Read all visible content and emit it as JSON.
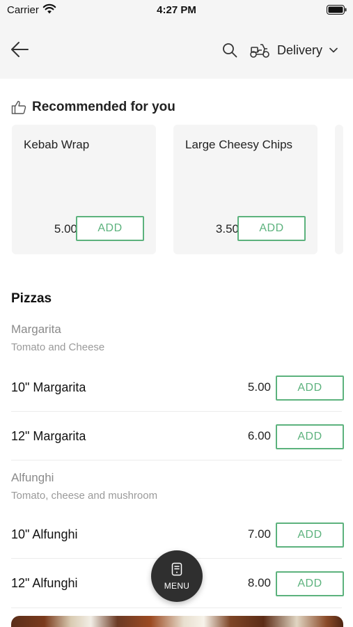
{
  "status_bar": {
    "carrier": "Carrier",
    "time": "4:27 PM"
  },
  "header": {
    "back_icon": "arrow-left-icon",
    "search_icon": "search-icon",
    "delivery_icon": "scooter-icon",
    "delivery_label": "Delivery",
    "chevron_icon": "chevron-down-icon"
  },
  "recommended": {
    "icon": "thumbs-up-icon",
    "title": "Recommended for you",
    "items": [
      {
        "name": "Kebab Wrap",
        "price": "5.00",
        "add_label": "ADD"
      },
      {
        "name": "Large Cheesy Chips",
        "price": "3.50",
        "add_label": "ADD"
      }
    ]
  },
  "menu": {
    "section_title": "Pizzas",
    "groups": [
      {
        "title": "Margarita",
        "description": "Tomato and Cheese",
        "items": [
          {
            "name": "10\" Margarita",
            "price": "5.00",
            "add_label": "ADD"
          },
          {
            "name": "12\" Margarita",
            "price": "6.00",
            "add_label": "ADD"
          }
        ]
      },
      {
        "title": "Alfunghi",
        "description": "Tomato, cheese and mushroom",
        "items": [
          {
            "name": "10\" Alfunghi",
            "price": "7.00",
            "add_label": "ADD"
          },
          {
            "name": "12\" Alfunghi",
            "price": "8.00",
            "add_label": "ADD"
          }
        ]
      }
    ]
  },
  "fab": {
    "icon": "menu-icon",
    "label": "MENU"
  },
  "colors": {
    "accent_green": "#5cb27d",
    "header_bg": "#f5f5f5",
    "card_bg": "#f5f5f5",
    "fab_bg": "#2f2f2f"
  }
}
